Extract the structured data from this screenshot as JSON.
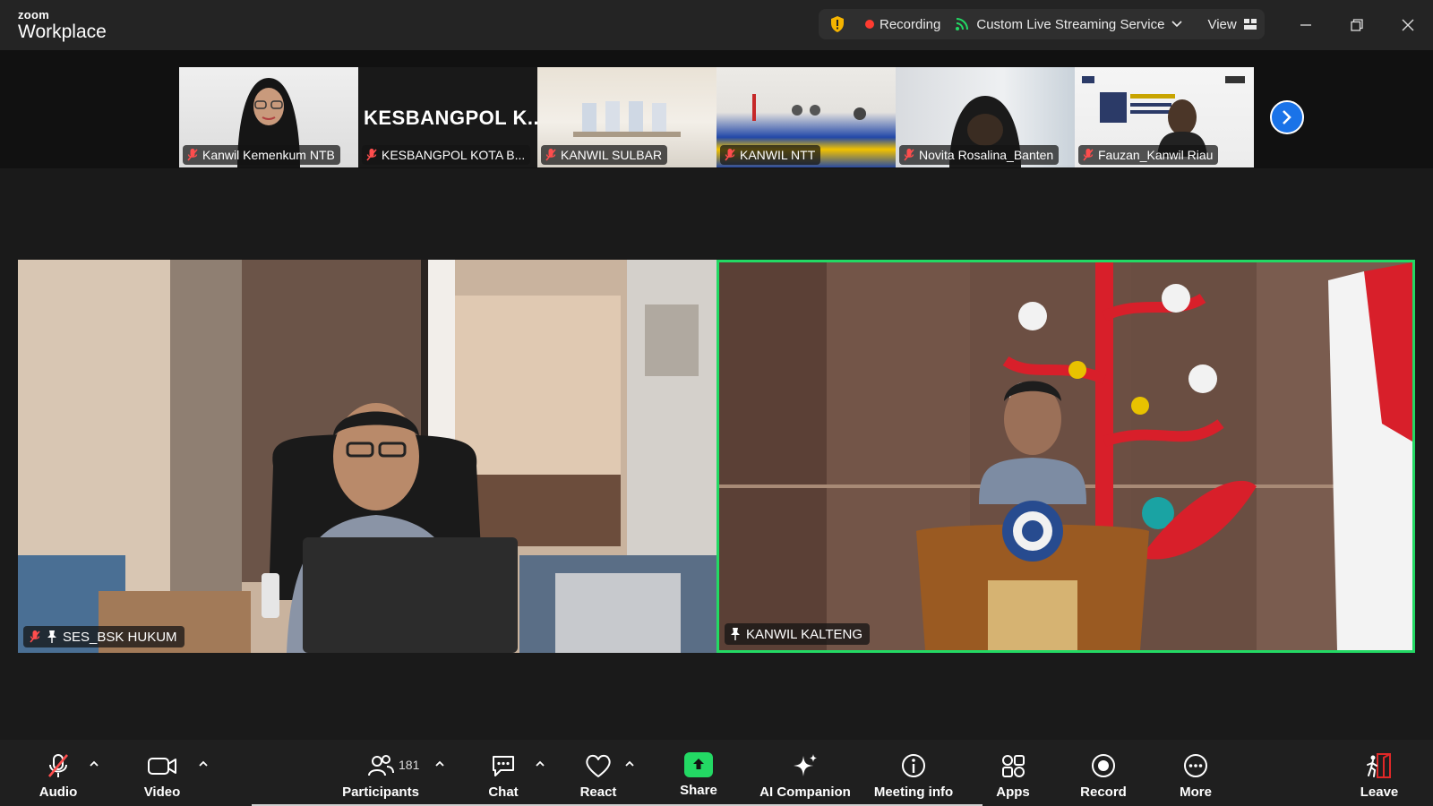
{
  "app": {
    "brand_small": "zoom",
    "brand_name": "Workplace"
  },
  "status": {
    "recording": "Recording",
    "streaming": "Custom Live Streaming Service",
    "view": "View"
  },
  "gallery": {
    "thumbs": [
      {
        "name": "Kanwil Kemenkum NTB"
      },
      {
        "name": "KESBANGPOL KOTA B...",
        "display": "KESBANGPOL  K..."
      },
      {
        "name": "KANWIL SULBAR"
      },
      {
        "name": "KANWIL NTT"
      },
      {
        "name": "Novita Rosalina_Banten"
      },
      {
        "name": "Fauzan_Kanwil Riau"
      }
    ]
  },
  "main": {
    "left": {
      "name": "SES_BSK HUKUM"
    },
    "right": {
      "name": "KANWIL KALTENG"
    }
  },
  "toolbar": {
    "audio": "Audio",
    "video": "Video",
    "participants": "Participants",
    "participants_count": "181",
    "chat": "Chat",
    "react": "React",
    "share": "Share",
    "ai": "AI Companion",
    "meeting_info": "Meeting info",
    "apps": "Apps",
    "record": "Record",
    "more": "More",
    "leave": "Leave"
  },
  "colors": {
    "accent_green": "#23d964",
    "recording_red": "#ff3b30",
    "nav_blue": "#1a73e8",
    "leave_red": "#e02828"
  }
}
